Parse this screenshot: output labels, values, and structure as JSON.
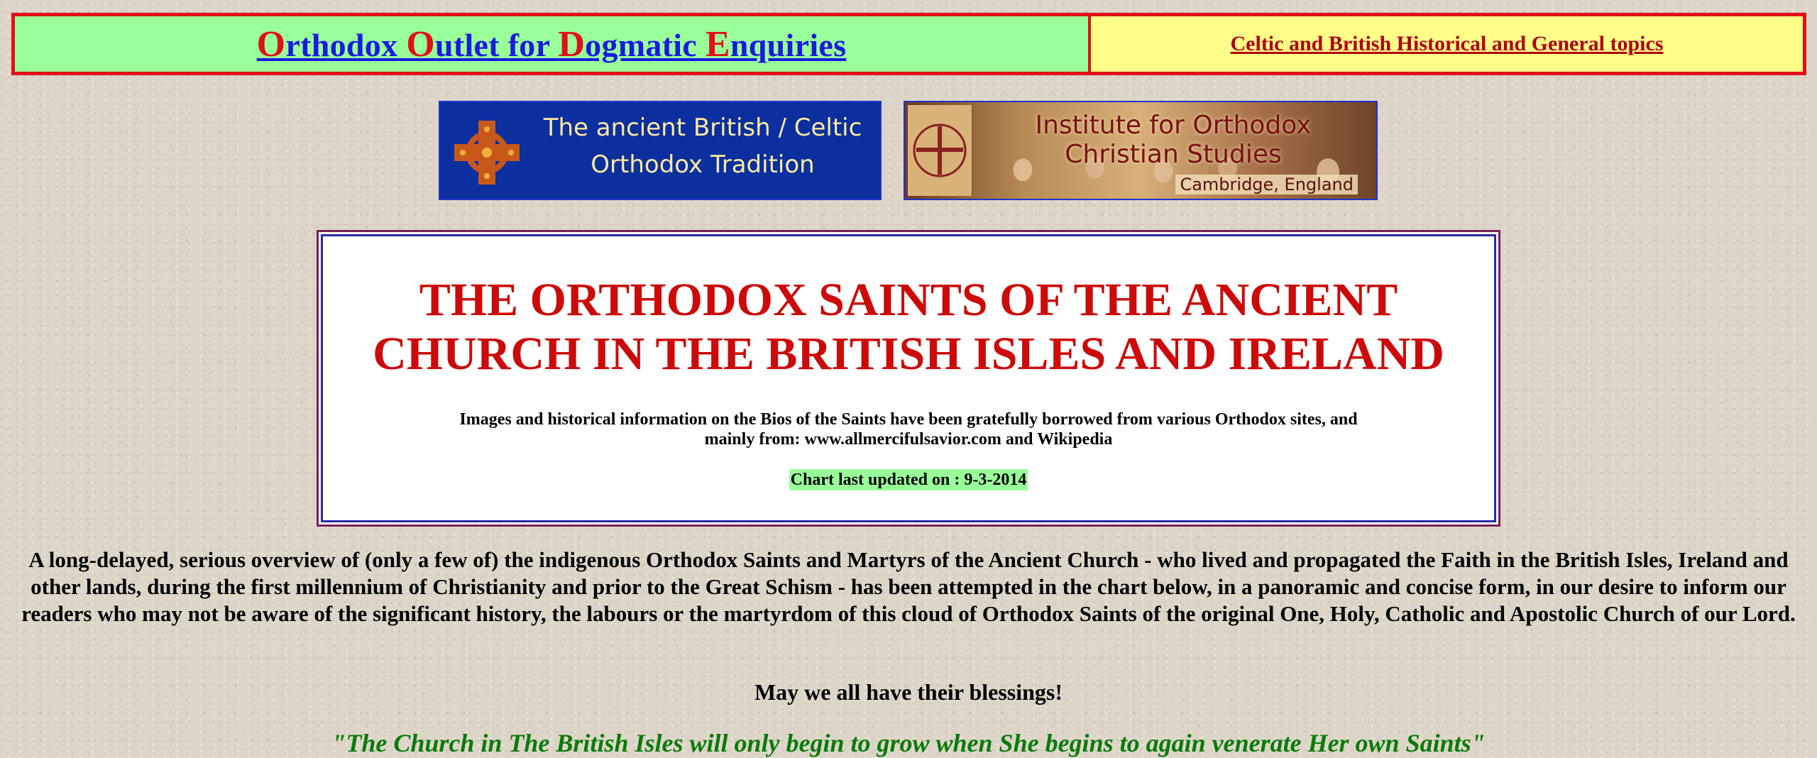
{
  "header": {
    "site_link": {
      "words": [
        {
          "cap": "O",
          "rest": "rthodox"
        },
        {
          "cap": "O",
          "rest": "utlet"
        },
        {
          "cap": "",
          "rest": "for"
        },
        {
          "cap": "D",
          "rest": "ogmatic"
        },
        {
          "cap": "E",
          "rest": "nquiries"
        }
      ]
    },
    "topic_link": "Celtic and British Historical and General topics"
  },
  "banners": {
    "celtic_line1": "The ancient British / Celtic",
    "celtic_line2": "Orthodox Tradition",
    "iocs_title": "Institute for Orthodox Christian Studies",
    "iocs_sub": "Cambridge, England"
  },
  "title_box": {
    "title_line1": "THE ORTHODOX SAINTS OF THE ANCIENT",
    "title_line2": "CHURCH IN THE BRITISH ISLES AND IRELAND",
    "credits": "Images and historical information on the Bios of the Saints have been gratefully borrowed from various Orthodox sites, and mainly from: www.allmercifulsavior.com and Wikipedia",
    "updated": "Chart last updated on :  9-3-2014"
  },
  "intro": "A long-delayed, serious overview of (only a few of) the indigenous Orthodox Saints and Martyrs of the Ancient Church - who lived and propagated the Faith in the British Isles, Ireland and other lands, during the first millennium of Christianity and prior to the Great Schism - has been attempted in the chart below, in a panoramic and concise form, in our desire to inform our readers who may not be aware of the significant history, the labours or the martyrdom of this cloud of Orthodox Saints of the original One, Holy, Catholic and Apostolic Church of our Lord.",
  "blessing": "May we all have their blessings!",
  "quote": "\"The Church in The British Isles will only begin to grow when She begins to again venerate Her own Saints\"",
  "colors": {
    "accent_red": "#e0101a",
    "link_blue": "#1a1ae0",
    "header_green": "#99ff99",
    "header_yellow": "#ffff88",
    "title_red": "#cc0a0a",
    "quote_green": "#0a7a0a"
  }
}
